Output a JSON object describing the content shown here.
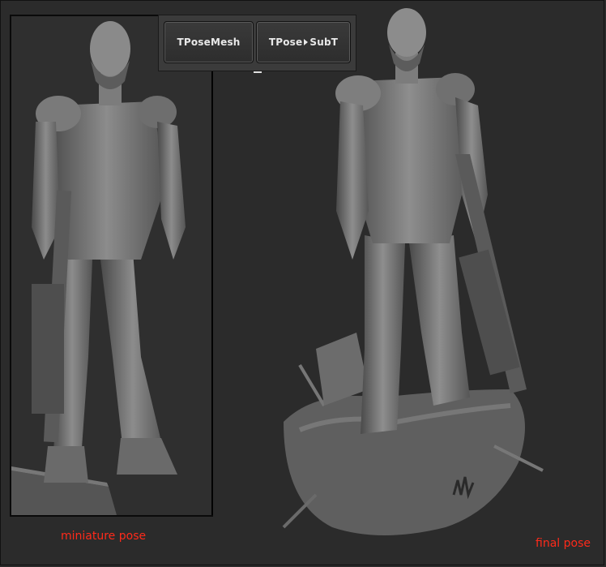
{
  "toolbar": {
    "button1_label": "TPoseMesh",
    "button2_label_part1": "TPose",
    "button2_label_part2": "SubT"
  },
  "captions": {
    "left": "miniature pose",
    "right": "final pose"
  },
  "colors": {
    "background": "#2b2b2b",
    "caption": "#ff2a1a",
    "model_gray": "#8a8a8a"
  },
  "icons": {
    "arrow": "right-triangle-icon"
  }
}
